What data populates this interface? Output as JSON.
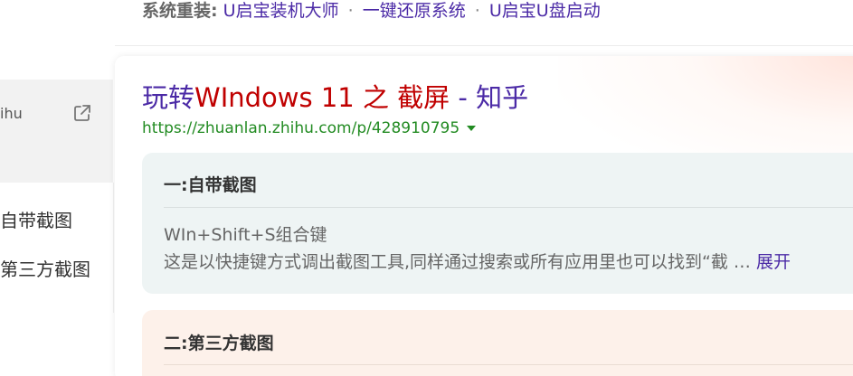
{
  "top_links": {
    "label": "系统重装:",
    "links": [
      "U启宝装机大师",
      "一键还原系统",
      "U启宝U盘启动"
    ],
    "separator": "·"
  },
  "left_panel": {
    "source_text": "ihu",
    "external_icon": "external-link-icon",
    "toc": [
      "自带截图",
      "第三方截图"
    ]
  },
  "result": {
    "title_part1": "玩转",
    "title_part2": "WIndows 11 之 截屏",
    "title_part3": " - 知乎",
    "url": "https://zhuanlan.zhihu.com/p/428910795",
    "url_caret_icon": "caret-down-icon"
  },
  "section1": {
    "heading": "一:自带截图",
    "line1": "WIn+Shift+S组合键",
    "line2": "这是以快捷键方式调出截图工具,同样通过搜索或所有应用里也可以找到“截 … ",
    "expand": "展开"
  },
  "section2": {
    "heading": "二:第三方截图"
  },
  "colors": {
    "link": "#4b2aa6",
    "highlight": "#c00000",
    "url": "#228b22",
    "section1_bg": "#eef4f4",
    "section2_bg": "#fdf1ea"
  }
}
